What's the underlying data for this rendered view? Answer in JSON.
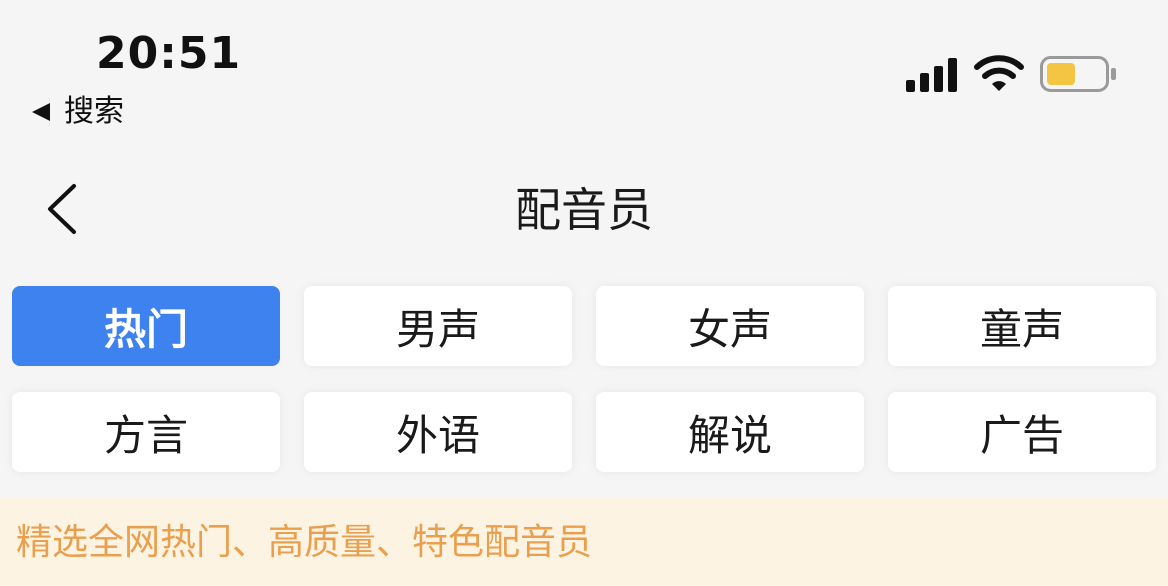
{
  "status_bar": {
    "time": "20:51",
    "back_app": "搜索",
    "icons": [
      "cellular-signal-icon",
      "wifi-icon",
      "battery-icon"
    ],
    "battery_level": 0.5,
    "battery_color": "#f4c542"
  },
  "nav": {
    "title": "配音员",
    "back_icon": "chevron-left-icon"
  },
  "categories": [
    {
      "label": "热门",
      "selected": true
    },
    {
      "label": "男声",
      "selected": false
    },
    {
      "label": "女声",
      "selected": false
    },
    {
      "label": "童声",
      "selected": false
    },
    {
      "label": "方言",
      "selected": false
    },
    {
      "label": "外语",
      "selected": false
    },
    {
      "label": "解说",
      "selected": false
    },
    {
      "label": "广告",
      "selected": false
    }
  ],
  "tip": {
    "text": "精选全网热门、高质量、特色配音员"
  },
  "colors": {
    "accent": "#3e82f0",
    "tip_background": "#fdf3e3",
    "tip_text": "#e9a04e"
  }
}
